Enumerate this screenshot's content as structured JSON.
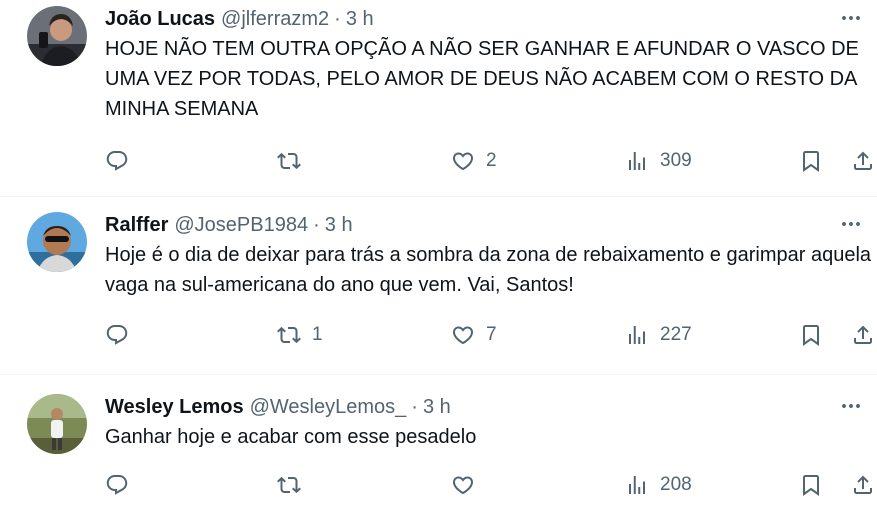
{
  "tweets": [
    {
      "name": "João Lucas",
      "handle": "@jlferrazm2",
      "separator": "·",
      "time": "3 h",
      "text": "HOJE NÃO TEM OUTRA OPÇÃO A NÃO SER GANHAR E AFUNDAR O VASCO DE UMA VEZ POR TODAS, PELO AMOR DE DEUS NÃO ACABEM COM O RESTO DA MINHA SEMANA",
      "replies": "",
      "retweets": "",
      "likes": "2",
      "views": "309"
    },
    {
      "name": "Ralffer",
      "handle": "@JosePB1984",
      "separator": "·",
      "time": "3 h",
      "text": "Hoje é o dia de deixar para trás a sombra da zona de rebaixamento e garimpar aquela vaga na sul-americana do ano que vem. Vai, Santos!",
      "replies": "",
      "retweets": "1",
      "likes": "7",
      "views": "227"
    },
    {
      "name": "Wesley Lemos",
      "handle": "@WesleyLemos_",
      "separator": "·",
      "time": "3 h",
      "text": "Ganhar hoje e acabar com esse pesadelo",
      "replies": "",
      "retweets": "",
      "likes": "",
      "views": "208"
    }
  ],
  "icons": {
    "reply": "reply-icon",
    "retweet": "retweet-icon",
    "like": "heart-icon",
    "views": "views-icon",
    "bookmark": "bookmark-icon",
    "share": "share-icon",
    "more": "more-icon"
  },
  "colors": {
    "text": "#0f1419",
    "secondary": "#536471",
    "divider": "#eff3f4"
  }
}
